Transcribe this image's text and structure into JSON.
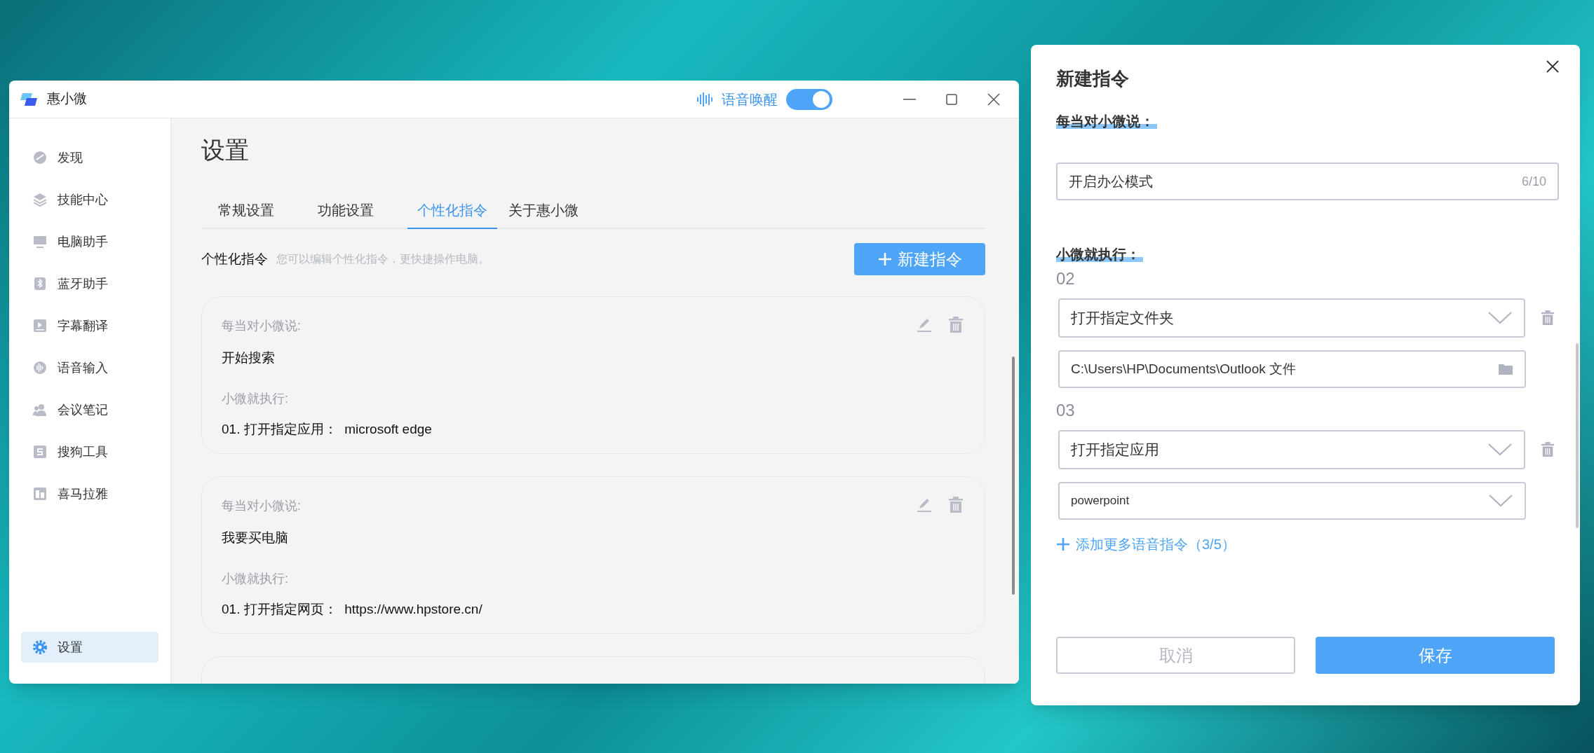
{
  "app_window": {
    "title": "惠小微",
    "voice_wake": {
      "label": "语音唤醒",
      "on": true
    },
    "sidebar": {
      "items": [
        {
          "label": "发现",
          "selected": false
        },
        {
          "label": "技能中心",
          "selected": false
        },
        {
          "label": "电脑助手",
          "selected": false
        },
        {
          "label": "蓝牙助手",
          "selected": false
        },
        {
          "label": "字幕翻译",
          "selected": false
        },
        {
          "label": "语音输入",
          "selected": false
        },
        {
          "label": "会议笔记",
          "selected": false
        },
        {
          "label": "搜狗工具",
          "selected": false
        },
        {
          "label": "喜马拉雅",
          "selected": false
        }
      ],
      "bottom_item": {
        "label": "设置",
        "selected": true
      }
    },
    "page_title": "设置",
    "tabs": [
      {
        "label": "常规设置",
        "selected": false
      },
      {
        "label": "功能设置",
        "selected": false
      },
      {
        "label": "个性化指令",
        "selected": true
      },
      {
        "label": "关于惠小微",
        "selected": false
      }
    ],
    "section": {
      "title": "个性化指令",
      "description": "您可以编辑个性化指令，更快捷操作电脑。",
      "new_button": "新建指令"
    },
    "commands": [
      {
        "say_label": "每当对小微说:",
        "phrase": "开始搜索",
        "exec_label": "小微就执行:",
        "actions": [
          "01. 打开指定应用：  microsoft edge"
        ]
      },
      {
        "say_label": "每当对小微说:",
        "phrase": "我要买电脑",
        "exec_label": "小微就执行:",
        "actions": [
          "01. 打开指定网页：  https://www.hpstore.cn/"
        ]
      }
    ]
  },
  "dialog": {
    "title": "新建指令",
    "say_label": "每当对小微说：",
    "phrase_field": {
      "value": "开启办公模式",
      "counter": "6/10"
    },
    "exec_label": "小微就执行：",
    "steps": [
      {
        "number": "02",
        "action": "打开指定文件夹",
        "target": {
          "kind": "path",
          "value": "C:\\Users\\HP\\Documents\\Outlook 文件"
        }
      },
      {
        "number": "03",
        "action": "打开指定应用",
        "target": {
          "kind": "select",
          "value": "powerpoint"
        }
      }
    ],
    "add_link": "添加更多语音指令（3/5）",
    "cancel": "取消",
    "save": "保存"
  }
}
